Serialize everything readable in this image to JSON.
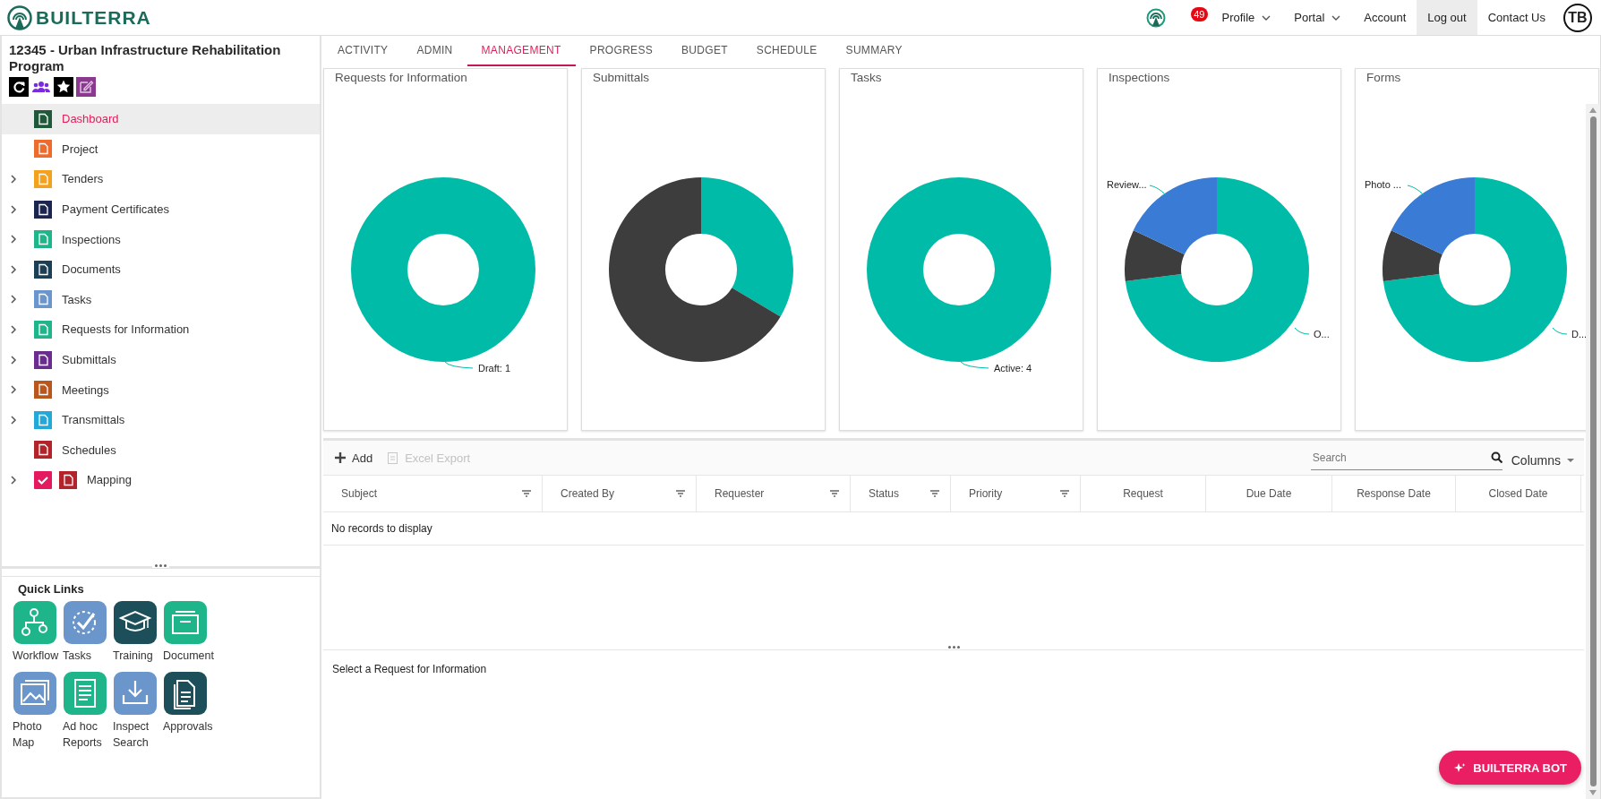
{
  "header": {
    "brand": "BUILTERRA",
    "notification_count": "49",
    "menu": [
      {
        "label": "Profile",
        "kind": "dropdown",
        "selected": false
      },
      {
        "label": "Portal",
        "kind": "dropdown",
        "selected": false
      },
      {
        "label": "Account",
        "kind": "link",
        "selected": false
      },
      {
        "label": "Log out",
        "kind": "link",
        "selected": true
      },
      {
        "label": "Contact Us",
        "kind": "link",
        "selected": false
      }
    ],
    "avatar": "TB"
  },
  "sidebar": {
    "project_title": "12345 - Urban Infrastructure Rehabilitation Program",
    "items": [
      {
        "label": "Dashboard",
        "color": "#1e5a3a",
        "expandable": false,
        "selected": true,
        "kind": "plain"
      },
      {
        "label": "Project",
        "color": "#ec6b2d",
        "expandable": false,
        "selected": false,
        "kind": "plain"
      },
      {
        "label": "Tenders",
        "color": "#f4a11d",
        "expandable": true,
        "selected": false,
        "kind": "plain"
      },
      {
        "label": "Payment Certificates",
        "color": "#1b2550",
        "expandable": true,
        "selected": false,
        "kind": "plain"
      },
      {
        "label": "Inspections",
        "color": "#1fb58a",
        "expandable": true,
        "selected": false,
        "kind": "plain"
      },
      {
        "label": "Documents",
        "color": "#1c3f55",
        "expandable": true,
        "selected": false,
        "kind": "plain"
      },
      {
        "label": "Tasks",
        "color": "#6b96cc",
        "expandable": true,
        "selected": false,
        "kind": "plain"
      },
      {
        "label": "Requests for Information",
        "color": "#1fb58a",
        "expandable": true,
        "selected": false,
        "kind": "plain"
      },
      {
        "label": "Submittals",
        "color": "#6a2d8f",
        "expandable": true,
        "selected": false,
        "kind": "plain"
      },
      {
        "label": "Meetings",
        "color": "#b9561d",
        "expandable": true,
        "selected": false,
        "kind": "plain"
      },
      {
        "label": "Transmittals",
        "color": "#22a9d8",
        "expandable": true,
        "selected": false,
        "kind": "plain"
      },
      {
        "label": "Schedules",
        "color": "#b3242a",
        "expandable": false,
        "selected": false,
        "kind": "plain"
      },
      {
        "label": "Mapping",
        "color": "#b3242a",
        "expandable": true,
        "selected": false,
        "kind": "check",
        "checked": true
      }
    ],
    "quick_links_title": "Quick Links",
    "quick_links": [
      {
        "label": "Workflow",
        "color": "#1fb58a"
      },
      {
        "label": "Tasks",
        "color": "#6b96cc"
      },
      {
        "label": "Training",
        "color": "#1c4f5a"
      },
      {
        "label": "Document",
        "color": "#1fb58a"
      },
      {
        "label": "Photo Map",
        "color": "#6b96cc"
      },
      {
        "label": "Ad hoc Reports",
        "color": "#1fb58a"
      },
      {
        "label": "Inspect Search",
        "color": "#6b96cc"
      },
      {
        "label": "Approvals",
        "color": "#1c4f5a"
      }
    ]
  },
  "tabs": [
    {
      "label": "ACTIVITY",
      "selected": false
    },
    {
      "label": "ADMIN",
      "selected": false
    },
    {
      "label": "MANAGEMENT",
      "selected": true
    },
    {
      "label": "PROGRESS",
      "selected": false
    },
    {
      "label": "BUDGET",
      "selected": false
    },
    {
      "label": "SCHEDULE",
      "selected": false
    },
    {
      "label": "SUMMARY",
      "selected": false
    }
  ],
  "charts": [
    {
      "title": "Requests for Information",
      "kind": "single",
      "labels": [
        {
          "text": "Draft: 1",
          "kind": "bottom"
        }
      ]
    },
    {
      "title": "Submittals",
      "kind": "two-part"
    },
    {
      "title": "Tasks",
      "kind": "single",
      "labels": [
        {
          "text": "Active: 4",
          "kind": "bottom"
        }
      ]
    },
    {
      "title": "Inspections",
      "kind": "three-part",
      "labels": [
        {
          "text": "Review...",
          "kind": "upper-left"
        },
        {
          "text": "O...",
          "kind": "right"
        }
      ]
    },
    {
      "title": "Forms",
      "kind": "three-part",
      "labels": [
        {
          "text": "Photo ...",
          "kind": "upper-left"
        },
        {
          "text": "D...",
          "kind": "right"
        }
      ]
    }
  ],
  "grid": {
    "toolbar": [
      {
        "label": "Add",
        "disabled": false
      },
      {
        "label": "Excel Export",
        "disabled": true
      }
    ],
    "search": {
      "placeholder": "Search"
    },
    "columns_button": "Columns",
    "columns": [
      {
        "label": "Subject",
        "filterable": true
      },
      {
        "label": "Created By",
        "filterable": true
      },
      {
        "label": "Requester",
        "filterable": true
      },
      {
        "label": "Status",
        "filterable": true
      },
      {
        "label": "Priority",
        "filterable": true
      },
      {
        "label": "Request",
        "filterable": false
      },
      {
        "label": "Due Date",
        "filterable": false
      },
      {
        "label": "Response Date",
        "filterable": false
      },
      {
        "label": "Closed Date",
        "filterable": false
      }
    ],
    "empty_message": "No records to display"
  },
  "detail": {
    "message": "Select a Request for Information"
  },
  "bot_button": "BUILTERRA BOT"
}
